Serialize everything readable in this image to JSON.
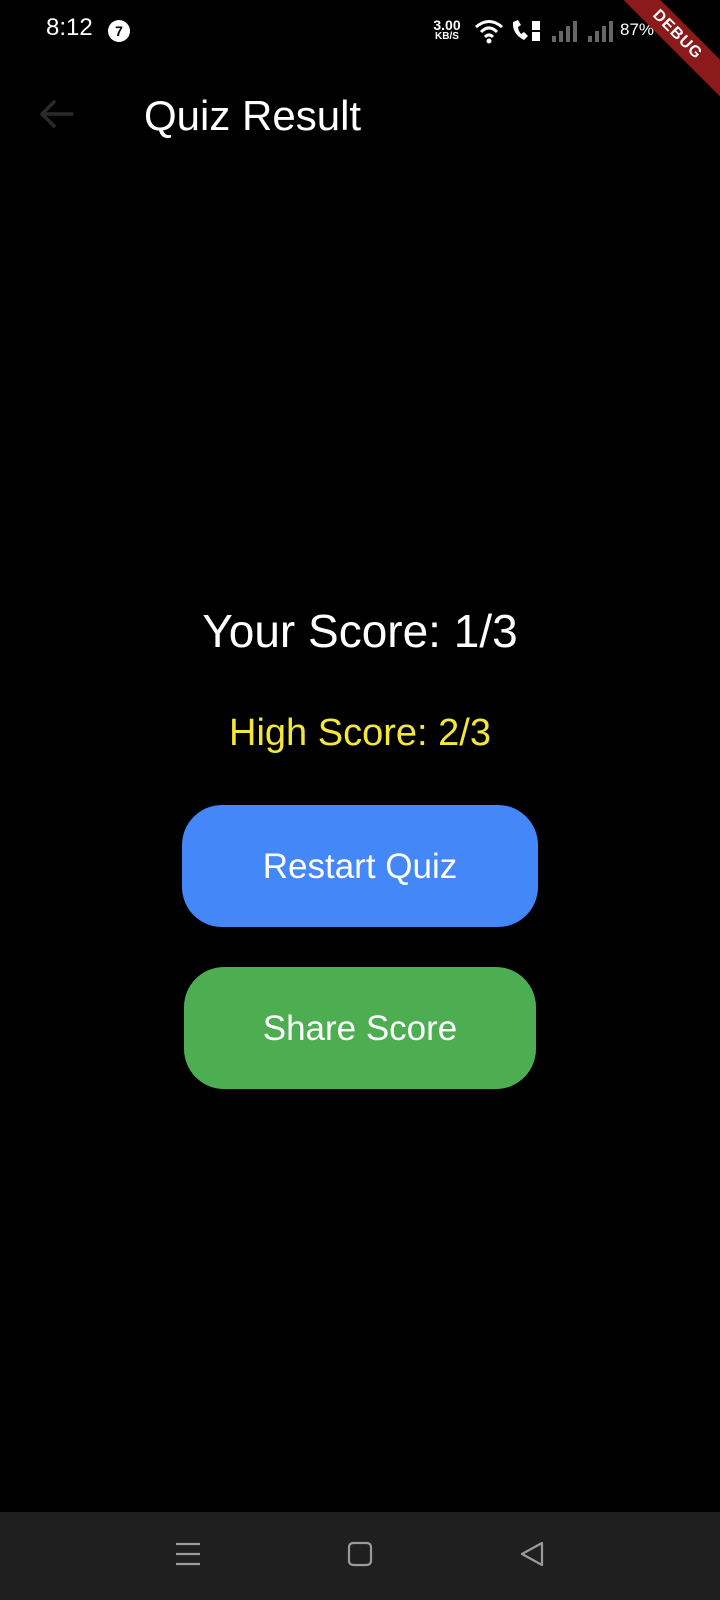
{
  "status_bar": {
    "time": "8:12",
    "notification_count": "7",
    "net_speed_value": "3.00",
    "net_speed_unit": "KB/S",
    "battery": "87%"
  },
  "debug_banner": "DEBUG",
  "app_bar": {
    "title": "Quiz Result",
    "back_icon": "arrow-back-icon"
  },
  "result": {
    "score": "Your Score: 1/3",
    "high_score": "High Score: 2/3"
  },
  "buttons": {
    "restart_label": "Restart Quiz",
    "share_label": "Share Score"
  },
  "nav_bar": {
    "items": [
      "menu-icon",
      "home-icon",
      "back-triangle-icon"
    ]
  },
  "colors": {
    "background": "#000000",
    "high_score": "#f5e63c",
    "restart_button": "#4487f8",
    "share_button": "#4cae50",
    "nav_bar": "#1f1f1f",
    "debug_banner": "#8b1a1a"
  }
}
